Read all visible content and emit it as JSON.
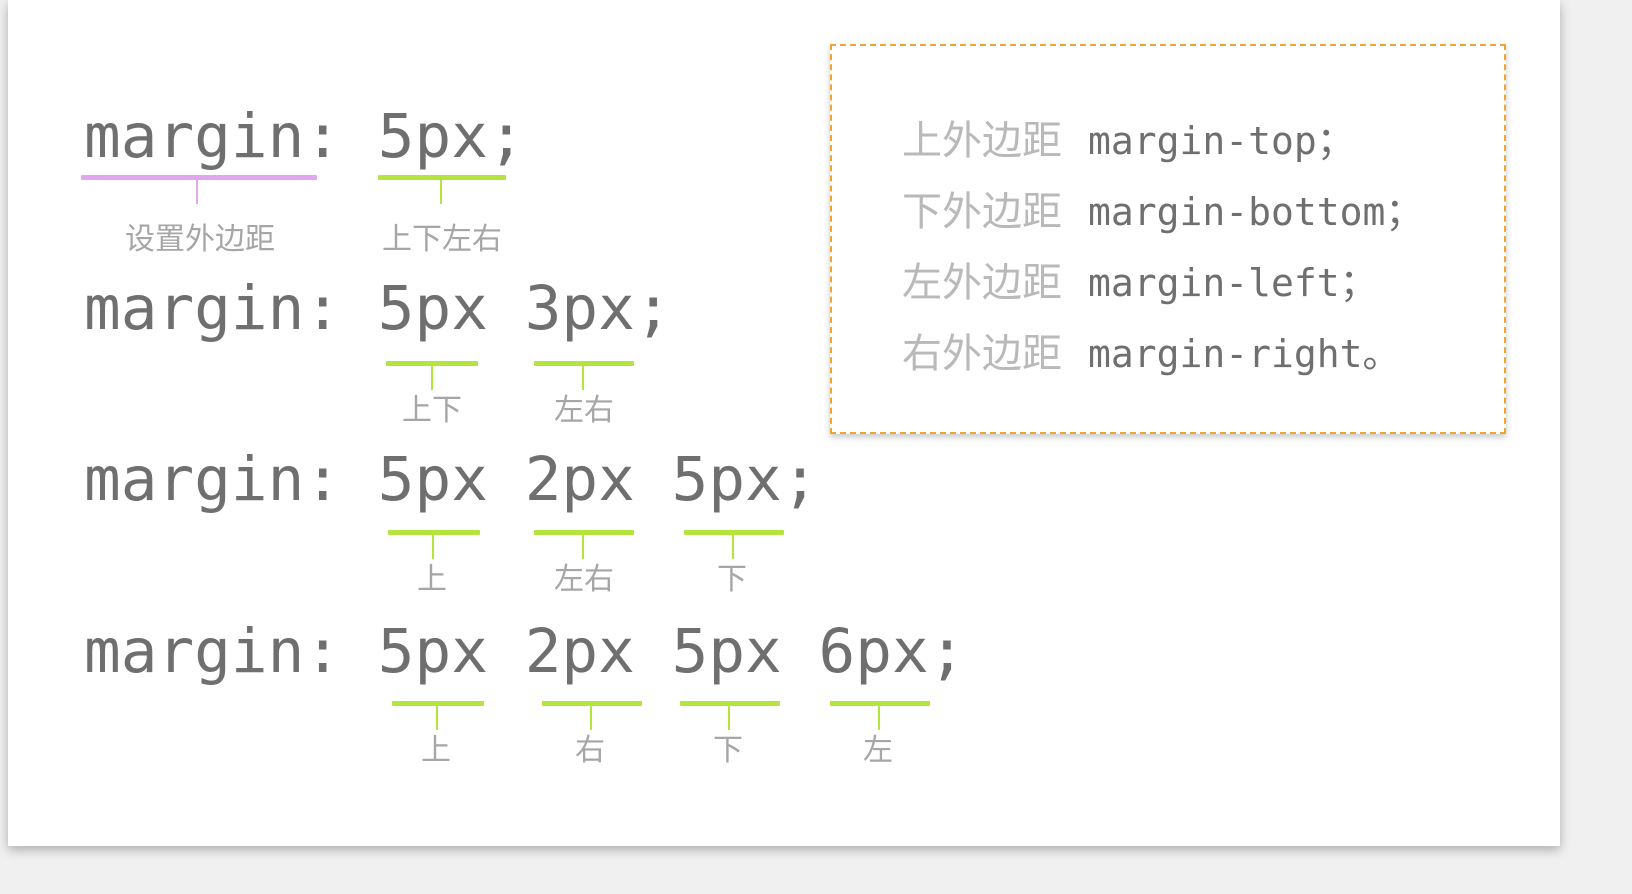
{
  "lines": [
    {
      "code": "margin: 5px;",
      "annotations": [
        {
          "label": "设置外边距"
        },
        {
          "label": "上下左右"
        }
      ]
    },
    {
      "code": "margin: 5px 3px;",
      "annotations": [
        {
          "label": "上下"
        },
        {
          "label": "左右"
        }
      ]
    },
    {
      "code": "margin: 5px 2px 5px;",
      "annotations": [
        {
          "label": "上"
        },
        {
          "label": "左右"
        },
        {
          "label": "下"
        }
      ]
    },
    {
      "code": "margin: 5px 2px 5px 6px;",
      "annotations": [
        {
          "label": "上"
        },
        {
          "label": "右"
        },
        {
          "label": "下"
        },
        {
          "label": "左"
        }
      ]
    }
  ],
  "legend": [
    {
      "cn": "上外边距",
      "code": "margin-top；"
    },
    {
      "cn": "下外边距",
      "code": "margin-bottom；"
    },
    {
      "cn": "左外边距",
      "code": "margin-left；"
    },
    {
      "cn": "右外边距",
      "code": "margin-right。"
    }
  ],
  "colors": {
    "underline_property": "#e2a6f0",
    "underline_value": "#b3e53e",
    "box_border": "#f2a433",
    "code_text": "#6f6f6f",
    "label_text": "#a6a6a6"
  }
}
